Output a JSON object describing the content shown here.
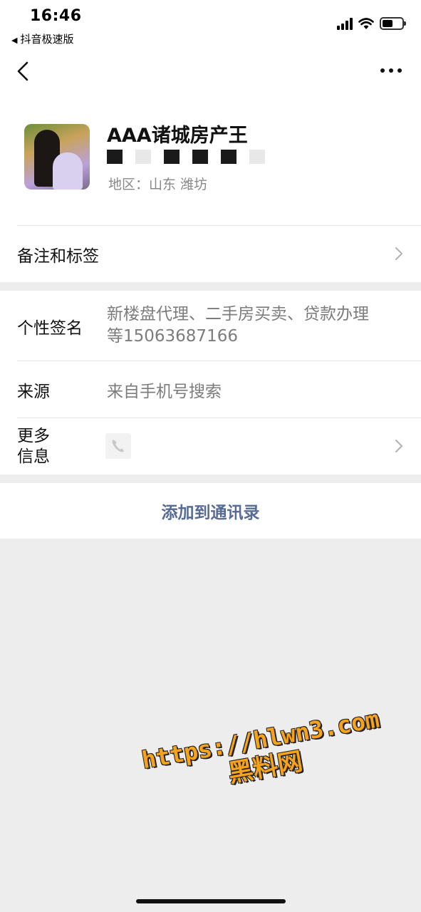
{
  "status_bar": {
    "time": "16:46",
    "back_app_label": "抖音极速版"
  },
  "profile": {
    "name": "AAA诸城房产王",
    "region": "地区：山东 潍坊"
  },
  "rows": {
    "remark_label": "备注和标签",
    "signature_label": "个性签名",
    "signature_line1": "新楼盘代理、二手房买卖、贷款办理",
    "signature_line2": "等15063687166",
    "source_label": "来源",
    "source_value": "来自手机号搜索",
    "more_info_line1": "更多",
    "more_info_line2": "信息"
  },
  "actions": {
    "add_contact": "添加到通讯录"
  },
  "watermark": {
    "url": "https://hlwn3.com",
    "text": "黑料网"
  },
  "colors": {
    "link": "#576b95",
    "watermark": "#f6a21a",
    "background": "#ededed"
  }
}
